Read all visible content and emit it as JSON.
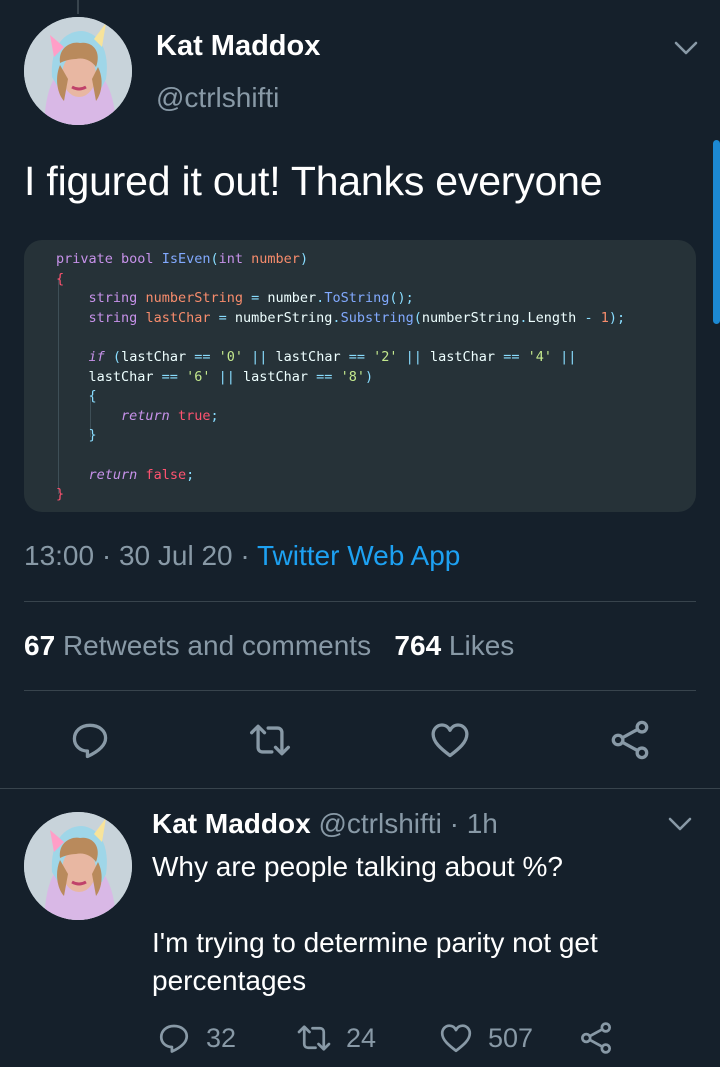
{
  "main_tweet": {
    "author_name": "Kat Maddox",
    "author_handle": "@ctrlshifti",
    "text": "I figured it out! Thanks everyone",
    "code_lines": [
      [
        [
          "kw",
          "private"
        ],
        [
          "t",
          " "
        ],
        [
          "kw",
          "bool"
        ],
        [
          "t",
          " "
        ],
        [
          "fn",
          "IsEven"
        ],
        [
          "pn",
          "("
        ],
        [
          "kw",
          "int"
        ],
        [
          "t",
          " "
        ],
        [
          "var",
          "number"
        ],
        [
          "pn",
          ")"
        ]
      ],
      [
        [
          "br",
          "{"
        ]
      ],
      [
        [
          "t",
          "    "
        ],
        [
          "kw",
          "string"
        ],
        [
          "t",
          " "
        ],
        [
          "var",
          "numberString"
        ],
        [
          "t",
          " "
        ],
        [
          "op",
          "="
        ],
        [
          "t",
          " number"
        ],
        [
          "op",
          "."
        ],
        [
          "fn",
          "ToString"
        ],
        [
          "pn",
          "();"
        ]
      ],
      [
        [
          "t",
          "    "
        ],
        [
          "kw",
          "string"
        ],
        [
          "t",
          " "
        ],
        [
          "var",
          "lastChar"
        ],
        [
          "t",
          " "
        ],
        [
          "op",
          "="
        ],
        [
          "t",
          " numberString"
        ],
        [
          "op",
          "."
        ],
        [
          "fn",
          "Substring"
        ],
        [
          "pn",
          "("
        ],
        [
          "t",
          "numberString"
        ],
        [
          "op",
          "."
        ],
        [
          "t",
          "Length "
        ],
        [
          "op",
          "-"
        ],
        [
          "t",
          " "
        ],
        [
          "num",
          "1"
        ],
        [
          "pn",
          ");"
        ]
      ],
      [
        [
          "t",
          ""
        ]
      ],
      [
        [
          "t",
          "    "
        ],
        [
          "ctl",
          "if"
        ],
        [
          "t",
          " "
        ],
        [
          "pn",
          "("
        ],
        [
          "t",
          "lastChar "
        ],
        [
          "op",
          "=="
        ],
        [
          "t",
          " "
        ],
        [
          "str",
          "'0'"
        ],
        [
          "t",
          " "
        ],
        [
          "op",
          "||"
        ],
        [
          "t",
          " lastChar "
        ],
        [
          "op",
          "=="
        ],
        [
          "t",
          " "
        ],
        [
          "str",
          "'2'"
        ],
        [
          "t",
          " "
        ],
        [
          "op",
          "||"
        ],
        [
          "t",
          " lastChar "
        ],
        [
          "op",
          "=="
        ],
        [
          "t",
          " "
        ],
        [
          "str",
          "'4'"
        ],
        [
          "t",
          " "
        ],
        [
          "op",
          "||"
        ]
      ],
      [
        [
          "t",
          "    lastChar "
        ],
        [
          "op",
          "=="
        ],
        [
          "t",
          " "
        ],
        [
          "str",
          "'6'"
        ],
        [
          "t",
          " "
        ],
        [
          "op",
          "||"
        ],
        [
          "t",
          " lastChar "
        ],
        [
          "op",
          "=="
        ],
        [
          "t",
          " "
        ],
        [
          "str",
          "'8'"
        ],
        [
          "pn",
          ")"
        ]
      ],
      [
        [
          "t",
          "    "
        ],
        [
          "pn",
          "{"
        ]
      ],
      [
        [
          "t",
          "        "
        ],
        [
          "ctl",
          "return"
        ],
        [
          "t",
          " "
        ],
        [
          "bool",
          "true"
        ],
        [
          "pn",
          ";"
        ]
      ],
      [
        [
          "t",
          "    "
        ],
        [
          "pn",
          "}"
        ]
      ],
      [
        [
          "t",
          ""
        ]
      ],
      [
        [
          "t",
          "    "
        ],
        [
          "ctl",
          "return"
        ],
        [
          "t",
          " "
        ],
        [
          "bool",
          "false"
        ],
        [
          "pn",
          ";"
        ]
      ],
      [
        [
          "br",
          "}"
        ]
      ]
    ],
    "time": "13:00",
    "date": "30 Jul 20",
    "source": "Twitter Web App",
    "retweets_count": "67",
    "retweets_label": "Retweets and comments",
    "likes_count": "764",
    "likes_label": "Likes"
  },
  "actions": {
    "reply_icon": "reply-icon",
    "retweet_icon": "retweet-icon",
    "like_icon": "heart-icon",
    "share_icon": "share-icon"
  },
  "reply_tweet": {
    "author_name": "Kat Maddox",
    "author_handle": "@ctrlshifti",
    "time": "1h",
    "paragraphs": [
      "Why are people talking about %?",
      "I'm trying to determine parity not get percentages"
    ],
    "reply_count": "32",
    "retweet_count": "24",
    "like_count": "507"
  },
  "colors": {
    "background": "#15202b",
    "text_secondary": "#8899a6",
    "link": "#1da1f2",
    "code_background": "#263238",
    "kw": "#c792ea",
    "fn": "#82aaff",
    "var": "#f78c6c",
    "op": "#89ddff",
    "str": "#c3e88d",
    "num": "#f78c6c",
    "bool": "#ff5370",
    "br": "#ff5370",
    "ctl": "#c792ea",
    "pn": "#89ddff",
    "t": "#eeffff"
  }
}
